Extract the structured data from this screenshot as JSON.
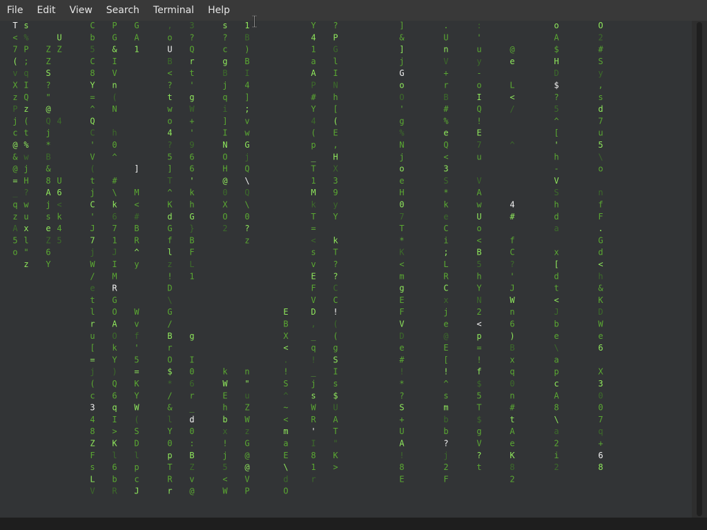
{
  "menubar": {
    "items": [
      "File",
      "Edit",
      "View",
      "Search",
      "Terminal",
      "Help"
    ]
  },
  "terminal": {
    "content": "cmatrix",
    "colors": {
      "bright": "#8fe85c",
      "mid": "#5aa832",
      "dim": "#3c6b2a",
      "head": "#f2f2f2",
      "background": "#323436"
    },
    "columns": [
      {
        "name": "c1",
        "glyphs": [
          "T",
          "<",
          "7",
          "(",
          "v",
          "X",
          "z",
          "P",
          "j",
          "c",
          "@",
          "&",
          "@",
          "=",
          "_",
          "q",
          "z",
          "A",
          "5",
          "o"
        ]
      },
      {
        "name": "c2",
        "glyphs": [
          "s",
          "%",
          "P",
          ";",
          "q",
          "I",
          "Q",
          "z",
          "(",
          "t",
          "%",
          "w",
          "j",
          "H",
          "?",
          "w",
          "u",
          "x",
          "l",
          "\"",
          "z"
        ]
      },
      {
        "name": "c3",
        "glyphs": [
          "",
          "",
          "Z",
          "Z",
          "S",
          "?",
          "\"",
          "@",
          "Q",
          "j",
          "*",
          "B",
          "&",
          "8",
          "A",
          "j",
          "s",
          "e",
          "Z",
          "6",
          "Y"
        ]
      },
      {
        "name": "c4",
        "glyphs": [
          "",
          "U",
          "Z",
          "",
          "",
          "",
          "",
          "",
          "4",
          "",
          "",
          "",
          "",
          "U",
          "6",
          "<",
          "k",
          "4",
          "5",
          ""
        ]
      },
      {
        "name": "c5",
        "glyphs": [
          "",
          "",
          "",
          "",
          "",
          "",
          "",
          "",
          "",
          "",
          "",
          "",
          "",
          "",
          "",
          "",
          "",
          "",
          "",
          ""
        ]
      },
      {
        "name": "c6",
        "glyphs": [
          "C",
          "b",
          "5",
          "C",
          "8",
          "Y",
          "=",
          "^",
          "Q",
          "C",
          "'",
          "V",
          "(",
          "t",
          "j",
          "C",
          "'",
          "J",
          "7",
          "j",
          "W",
          "/",
          "e",
          "t",
          "l",
          "r",
          "u",
          "[",
          "=",
          "j",
          "(",
          "c",
          "3",
          "4",
          "8",
          "Z",
          "F",
          "s",
          "L",
          "V"
        ]
      },
      {
        "name": "c7",
        "glyphs": [
          "P",
          "G",
          "&",
          "I",
          "V",
          "n",
          "(",
          "N",
          "",
          "h",
          "0",
          "^",
          "",
          "#",
          "\\",
          "k",
          "6",
          "7",
          "1",
          "J",
          "I",
          "M",
          "R",
          "G",
          "O",
          "A",
          "O",
          "k",
          "Y",
          ")",
          "Q",
          "6",
          "q",
          "I",
          ">",
          "K",
          "l",
          "6",
          "b",
          "R"
        ]
      },
      {
        "name": "c8",
        "glyphs": [
          "G",
          "A",
          "1",
          "",
          "",
          "",
          "",
          "",
          "",
          "",
          "",
          "",
          "]",
          "",
          "M",
          "<",
          "#",
          "B",
          "R",
          "^",
          "y",
          "",
          "",
          "",
          "W",
          "v",
          "f",
          "'",
          "5",
          "=",
          "K",
          "Y",
          "W",
          "(",
          "S",
          "D",
          "l",
          "p",
          "c",
          "J"
        ]
      },
      {
        "name": "c9",
        "glyphs": [
          ",",
          "o",
          "U",
          "B",
          "<",
          "?",
          "t",
          "w",
          "o",
          "4",
          "?",
          "5",
          "]",
          "T",
          "^",
          "K",
          "d",
          "G",
          "f",
          "l",
          "z",
          "!",
          "D",
          "\\",
          "G",
          "/",
          "B",
          "r",
          "O",
          "$",
          "*",
          "/",
          "&",
          "l",
          "Y",
          "0",
          "p",
          "T",
          "R",
          "r"
        ]
      },
      {
        "name": "c10",
        "glyphs": [
          "3",
          "?",
          "Q",
          "r",
          "t",
          "'",
          "g",
          "W",
          "+",
          "'",
          "9",
          "6",
          "6",
          "'",
          "k",
          "h",
          "G",
          "}",
          "B",
          "F",
          "L",
          "1",
          "",
          "",
          "",
          "",
          "g",
          "",
          "I",
          "0",
          "6",
          "r",
          "_",
          "d",
          "0",
          ":",
          "B",
          "Z",
          "v",
          "@"
        ]
      },
      {
        "name": "c11",
        "glyphs": [
          "s",
          "?",
          "c",
          "g",
          "B",
          "j",
          "q",
          "i",
          "]",
          "I",
          "N",
          "O",
          "H",
          "@",
          "0",
          "X",
          "O",
          "2",
          "",
          "",
          "",
          "",
          "",
          "",
          "",
          "",
          "",
          "",
          "",
          "k",
          "W",
          "E",
          "h",
          "b",
          "x",
          "!",
          "j",
          "5",
          "<",
          "W"
        ]
      },
      {
        "name": "c12",
        "glyphs": [
          "1",
          "B",
          ")",
          "B",
          "I",
          "4",
          "]",
          ";",
          "v",
          "w",
          "G",
          "j",
          "Q",
          "\\",
          "Q",
          "\\",
          "0",
          "?",
          "z",
          "",
          "",
          "",
          "",
          "",
          "",
          "",
          "",
          "",
          "",
          "n",
          "\"",
          "u",
          "Z",
          "W",
          "z",
          "G",
          "@",
          "@",
          "V",
          "P"
        ]
      },
      {
        "name": "c13",
        "glyphs": [
          "",
          "",
          "",
          "",
          "",
          "",
          "",
          "",
          "",
          "",
          "",
          "",
          "",
          "",
          "",
          "",
          "",
          "",
          "",
          "",
          "",
          "",
          "",
          "",
          "E",
          "B",
          "X",
          "<",
          ".",
          "!",
          "S",
          "^",
          "~",
          "<",
          "m",
          "a",
          "E",
          "\\",
          "d",
          "O"
        ]
      },
      {
        "name": "c14",
        "glyphs": [
          "Y",
          "4",
          "1",
          "a",
          "A",
          "P",
          "#",
          "Y",
          "4",
          "(",
          "p",
          "_",
          "T",
          "1",
          "M",
          "k",
          "T",
          "=",
          "<",
          "s",
          "v",
          "E",
          "F",
          "V",
          "D",
          ",",
          "_",
          "q",
          "!",
          "_",
          "j",
          "s",
          "W",
          "R",
          "'",
          "I",
          "8",
          "1",
          "r"
        ]
      },
      {
        "name": "c15",
        "glyphs": [
          "?",
          "P",
          "G",
          "l",
          "I",
          "N",
          "h",
          "[",
          "(",
          "E",
          ",",
          "H",
          "X",
          "3",
          "9",
          "y",
          "Y",
          "",
          "k",
          "T",
          "?",
          "?",
          "C",
          "C",
          "!",
          "(",
          "(",
          "g",
          "S",
          "I",
          "s",
          "$",
          "U",
          "A",
          "T",
          "\"",
          "K",
          ">"
        ]
      },
      {
        "name": "c16",
        "glyphs": [
          "",
          "",
          "",
          "",
          "",
          "",
          "",
          "",
          "",
          "",
          "",
          "",
          "",
          "",
          "",
          "",
          "",
          "",
          "",
          "",
          "",
          "",
          "",
          "",
          "",
          "",
          "",
          "",
          "",
          "",
          "",
          "",
          "",
          "",
          "",
          "",
          "",
          "",
          ""
        ]
      },
      {
        "name": "c17",
        "glyphs": [
          "]",
          "&",
          "]",
          "j",
          "G",
          "o",
          "O",
          "'",
          "g",
          "%",
          "N",
          "j",
          "o",
          "e",
          "H",
          "0",
          "7",
          "T",
          "*",
          "K",
          "<",
          "m",
          "g",
          "E",
          "F",
          "V",
          "D",
          "e",
          "#",
          "!",
          "*",
          "?",
          "S",
          "+",
          "U",
          "A",
          "!",
          "8",
          "E"
        ]
      },
      {
        "name": "c18",
        "glyphs": [
          ".",
          "U",
          "n",
          "V",
          "+",
          "r",
          "B",
          "#",
          "%",
          "e",
          "Q",
          "<",
          "3",
          "S",
          "*",
          "k",
          "e",
          "C",
          "i",
          ";",
          "L",
          "R",
          "C",
          "x",
          "j",
          "e",
          "@",
          "E",
          "[",
          "!",
          "^",
          "s",
          "m",
          "b",
          "b",
          "?",
          "j",
          "2",
          "F"
        ]
      },
      {
        "name": "c19",
        "glyphs": [
          ":",
          "'",
          "u",
          "y",
          "-",
          "o",
          "I",
          "Q",
          "!",
          "E",
          "7",
          "u",
          "",
          "V",
          "A",
          "w",
          "U",
          "o",
          "<",
          "B",
          "5",
          "h",
          "Y",
          "N",
          "2",
          "<",
          "p",
          "=",
          "!",
          "f",
          "$",
          "5",
          "T",
          "$",
          "g",
          "V",
          "?",
          "t"
        ]
      },
      {
        "name": "c20",
        "glyphs": [
          "",
          "",
          "@",
          "e",
          "",
          "L",
          "<",
          "/",
          "",
          "",
          "^",
          "",
          "",
          "",
          "",
          "4",
          "#",
          "",
          "f",
          "C",
          "?",
          "'",
          "J",
          "W",
          "n",
          "6",
          ")",
          "B",
          "x",
          "q",
          "0",
          "n",
          "#",
          "t",
          "A",
          "e",
          "K",
          "8",
          "2"
        ]
      },
      {
        "name": "c21",
        "glyphs": [
          "o",
          "A",
          "$",
          "H",
          "D",
          "$",
          "?",
          "5",
          "^",
          "[",
          "'",
          "h",
          "-",
          "V",
          "S",
          "h",
          "d",
          "a",
          "",
          "x",
          "[",
          "d",
          "t",
          "<",
          "J",
          "b",
          "e",
          "\\",
          "a",
          "p",
          "c",
          "A",
          "8",
          "\\",
          "a",
          "2",
          "i",
          "2"
        ]
      },
      {
        "name": "c22",
        "glyphs": [
          "O",
          "2",
          "#",
          "S",
          "y",
          ",",
          "s",
          "d",
          "7",
          "u",
          "5",
          "\\",
          "o",
          "",
          "n",
          "f",
          "F",
          ".",
          "G",
          "d",
          "<",
          "h",
          "&",
          "K",
          "D",
          "W",
          "e",
          "6",
          "",
          "X",
          "3",
          "0",
          "0",
          "7",
          "q",
          "+",
          "6",
          "8"
        ]
      }
    ]
  }
}
